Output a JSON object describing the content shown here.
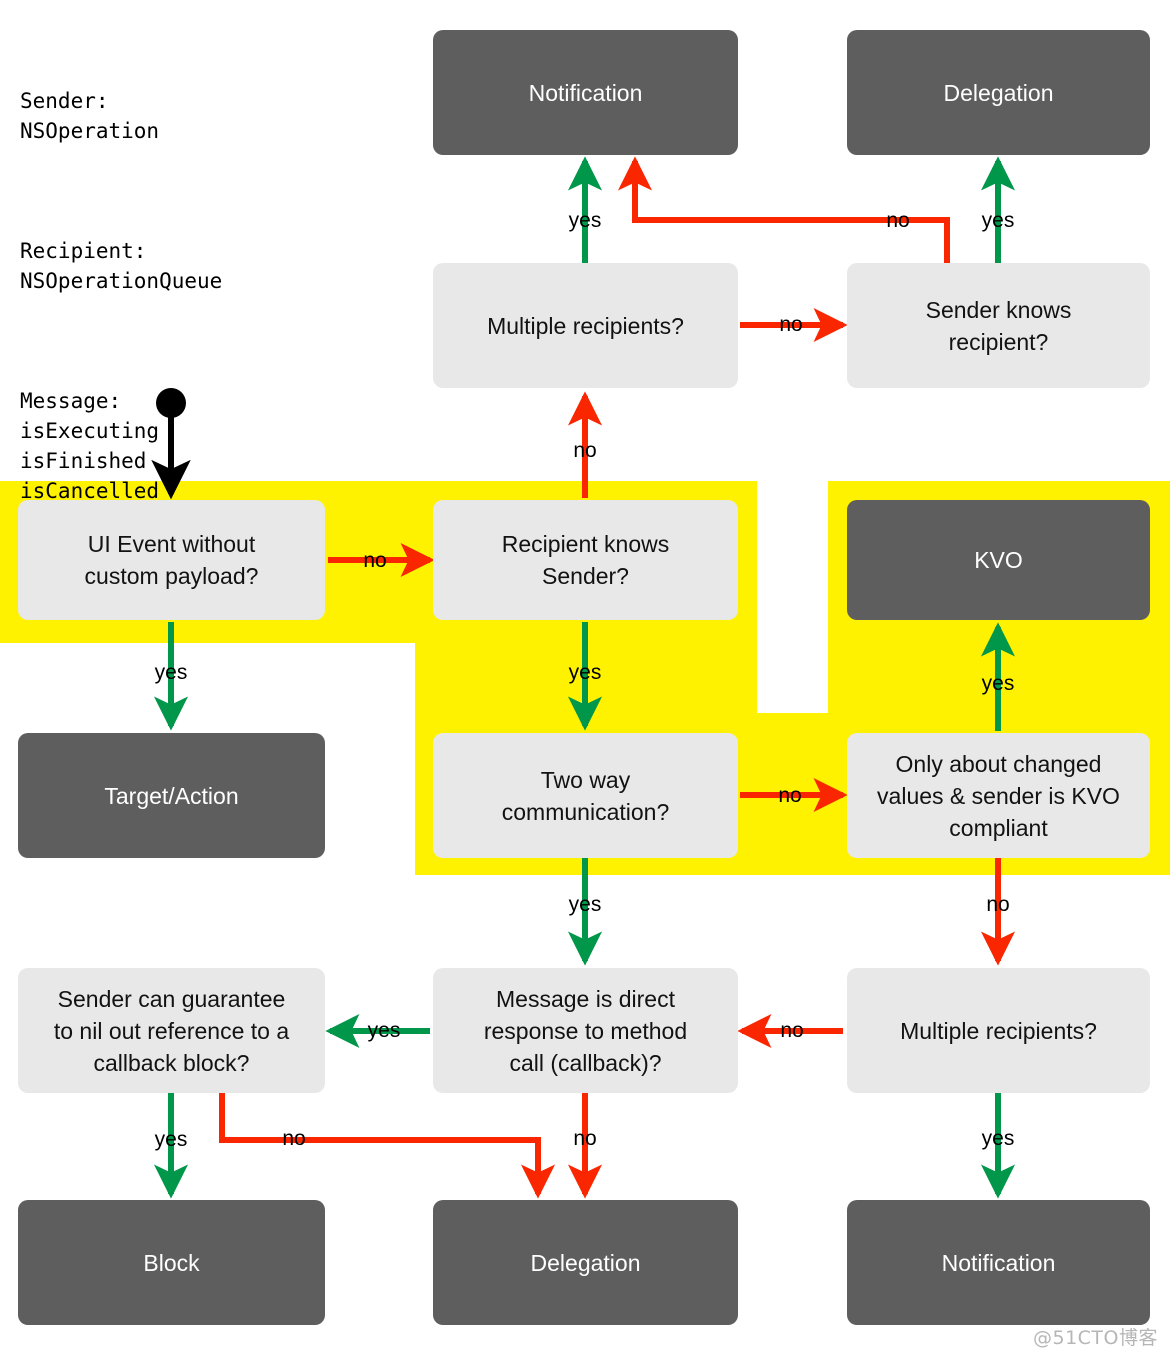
{
  "title": "Cocoa Communication Patterns Decision Flowchart",
  "colors": {
    "yes_green": "#00974a",
    "no_red": "#fa2600",
    "highlight_yellow": "#fff200",
    "decision_bg": "#e8e8e8",
    "terminal_bg": "#5e5e5e",
    "terminal_text": "#ffffff",
    "decision_text": "#121212",
    "start_black": "#000000",
    "page_bg": "#ffffff"
  },
  "legend": {
    "sender_label": "Sender:",
    "sender_value": "NSOperation",
    "recipient_label": "Recipient:",
    "recipient_value": "NSOperationQueue",
    "message_label": "Message:",
    "message_values": "isExecuting\nisFinished\nisCancelled"
  },
  "nodes": {
    "notification_top": "Notification",
    "delegation_top": "Delegation",
    "multiple_recipients_top": "Multiple recipients?",
    "sender_knows_recipient": "Sender knows\nrecipient?",
    "ui_event": "UI Event without\ncustom payload?",
    "recipient_knows_sender": "Recipient knows\nSender?",
    "kvo": "KVO",
    "target_action": "Target/Action",
    "two_way_communication": "Two way\ncommunication?",
    "kvo_compliant": "Only about changed\nvalues & sender is KVO\ncompliant",
    "sender_nil_out": "Sender can guarantee\nto nil out reference to a\ncallback block?",
    "direct_response": "Message is direct\nresponse to method\ncall (callback)?",
    "multiple_recipients_bottom": "Multiple recipients?",
    "block_bottom": "Block",
    "delegation_bottom": "Delegation",
    "notification_bottom": "Notification"
  },
  "edge_labels": {
    "yes_notification_top": "yes",
    "no_to_notification_top": "no",
    "yes_delegation_top": "yes",
    "no_multiple_to_sender_knows": "no",
    "no_recipient_to_multiple": "no",
    "no_ui_event_to_recipient": "no",
    "yes_ui_event_to_target": "yes",
    "yes_recipient_to_twoway": "yes",
    "yes_kvo_compliant_to_kvo": "yes",
    "no_twoway_to_kvo_compliant": "no",
    "yes_twoway_to_direct": "yes",
    "no_kvo_compliant_to_multiple": "no",
    "yes_direct_to_sender_nil": "yes",
    "no_multiple_bottom_to_direct": "no",
    "yes_sender_nil_to_block": "yes",
    "no_sender_nil_to_delegation": "no",
    "no_direct_to_delegation": "no",
    "yes_multiple_bottom_to_notification": "yes"
  },
  "watermark": "@51CTO博客"
}
